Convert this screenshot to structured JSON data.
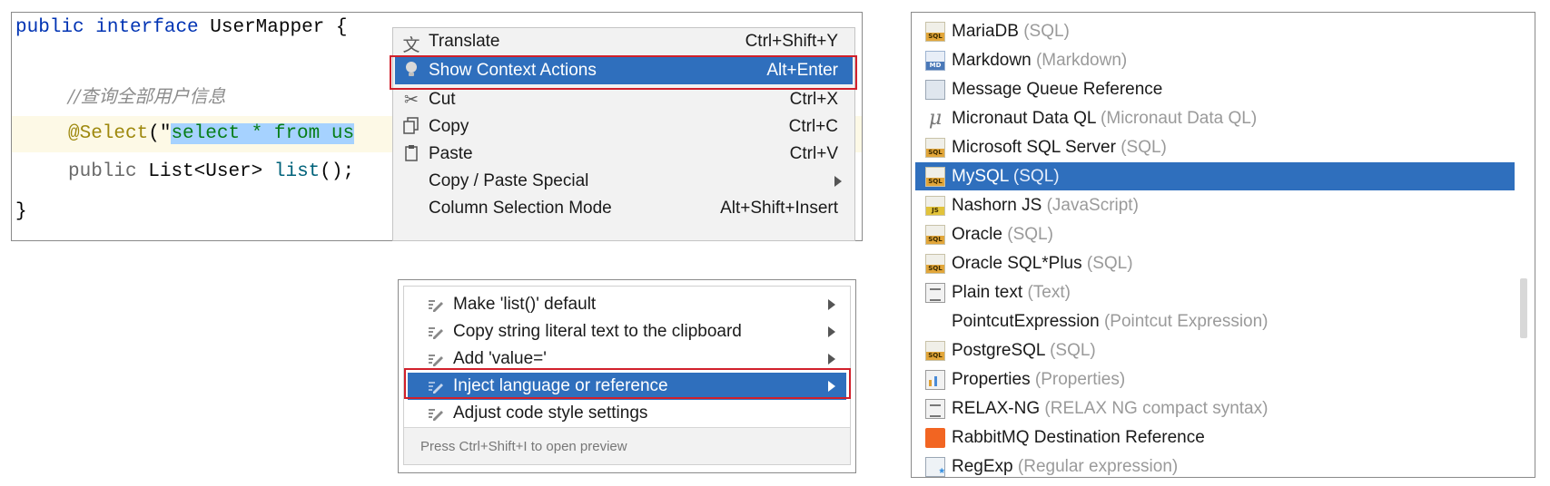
{
  "editor": {
    "sig_public": "public",
    "sig_interface": "interface",
    "sig_name": "UserMapper",
    "sig_brace": "{",
    "comment": "//查询全部用户信息",
    "annotation": "@Select",
    "annot_open": "(\"",
    "selected_sql": "select * from us",
    "method_public": "public",
    "method_type": "List<User>",
    "method_name": "list",
    "method_rest": "();",
    "close_brace": "}"
  },
  "context_menu": {
    "items": [
      {
        "icon": "translate-icon",
        "label": "Translate",
        "shortcut": "Ctrl+Shift+Y"
      },
      {
        "icon": "lightbulb-icon",
        "label": "Show Context Actions",
        "shortcut": "Alt+Enter",
        "selected": true
      },
      {
        "icon": "scissors-icon",
        "label": "Cut",
        "shortcut": "Ctrl+X"
      },
      {
        "icon": "copy-icon",
        "label": "Copy",
        "shortcut": "Ctrl+C"
      },
      {
        "icon": "paste-icon",
        "label": "Paste",
        "shortcut": "Ctrl+V"
      },
      {
        "icon": "",
        "label": "Copy / Paste Special",
        "shortcut": ""
      },
      {
        "icon": "",
        "label": "Column Selection Mode",
        "shortcut": "Alt+Shift+Insert"
      }
    ]
  },
  "intentions": {
    "items": [
      {
        "label": "Make 'list()' default"
      },
      {
        "label": "Copy string literal text to the clipboard"
      },
      {
        "label": "Add 'value='"
      },
      {
        "label": "Inject language or reference",
        "selected": true
      },
      {
        "label": "Adjust code style settings"
      }
    ],
    "footer": "Press Ctrl+Shift+I to open preview"
  },
  "languages": [
    {
      "icon": "sql-icon",
      "name": "MariaDB",
      "sub": "(SQL)"
    },
    {
      "icon": "markdown-icon",
      "name": "Markdown",
      "sub": "(Markdown)"
    },
    {
      "icon": "message-queue-icon",
      "name": "Message Queue Reference",
      "sub": ""
    },
    {
      "icon": "micronaut-icon",
      "name": "Micronaut Data QL",
      "sub": "(Micronaut Data QL)"
    },
    {
      "icon": "sql-icon",
      "name": "Microsoft SQL Server",
      "sub": "(SQL)"
    },
    {
      "icon": "sql-icon",
      "name": "MySQL",
      "sub": "(SQL)",
      "selected": true
    },
    {
      "icon": "javascript-icon",
      "name": "Nashorn JS",
      "sub": "(JavaScript)"
    },
    {
      "icon": "sql-icon",
      "name": "Oracle",
      "sub": "(SQL)"
    },
    {
      "icon": "sql-icon",
      "name": "Oracle SQL*Plus",
      "sub": "(SQL)"
    },
    {
      "icon": "text-file-icon",
      "name": "Plain text",
      "sub": "(Text)"
    },
    {
      "icon": "",
      "name": "PointcutExpression",
      "sub": "(Pointcut Expression)"
    },
    {
      "icon": "sql-icon",
      "name": "PostgreSQL",
      "sub": "(SQL)"
    },
    {
      "icon": "properties-icon",
      "name": "Properties",
      "sub": "(Properties)"
    },
    {
      "icon": "text-file-icon",
      "name": "RELAX-NG",
      "sub": "(RELAX NG compact syntax)"
    },
    {
      "icon": "rabbitmq-icon",
      "name": "RabbitMQ Destination Reference",
      "sub": ""
    },
    {
      "icon": "regexp-icon",
      "name": "RegExp",
      "sub": "(Regular expression)"
    }
  ],
  "colors": {
    "selection": "#2f6fbd",
    "highlight_box": "#d1202b",
    "keyword": "#0033b3",
    "string": "#067d17",
    "annotation": "#9e880d"
  }
}
